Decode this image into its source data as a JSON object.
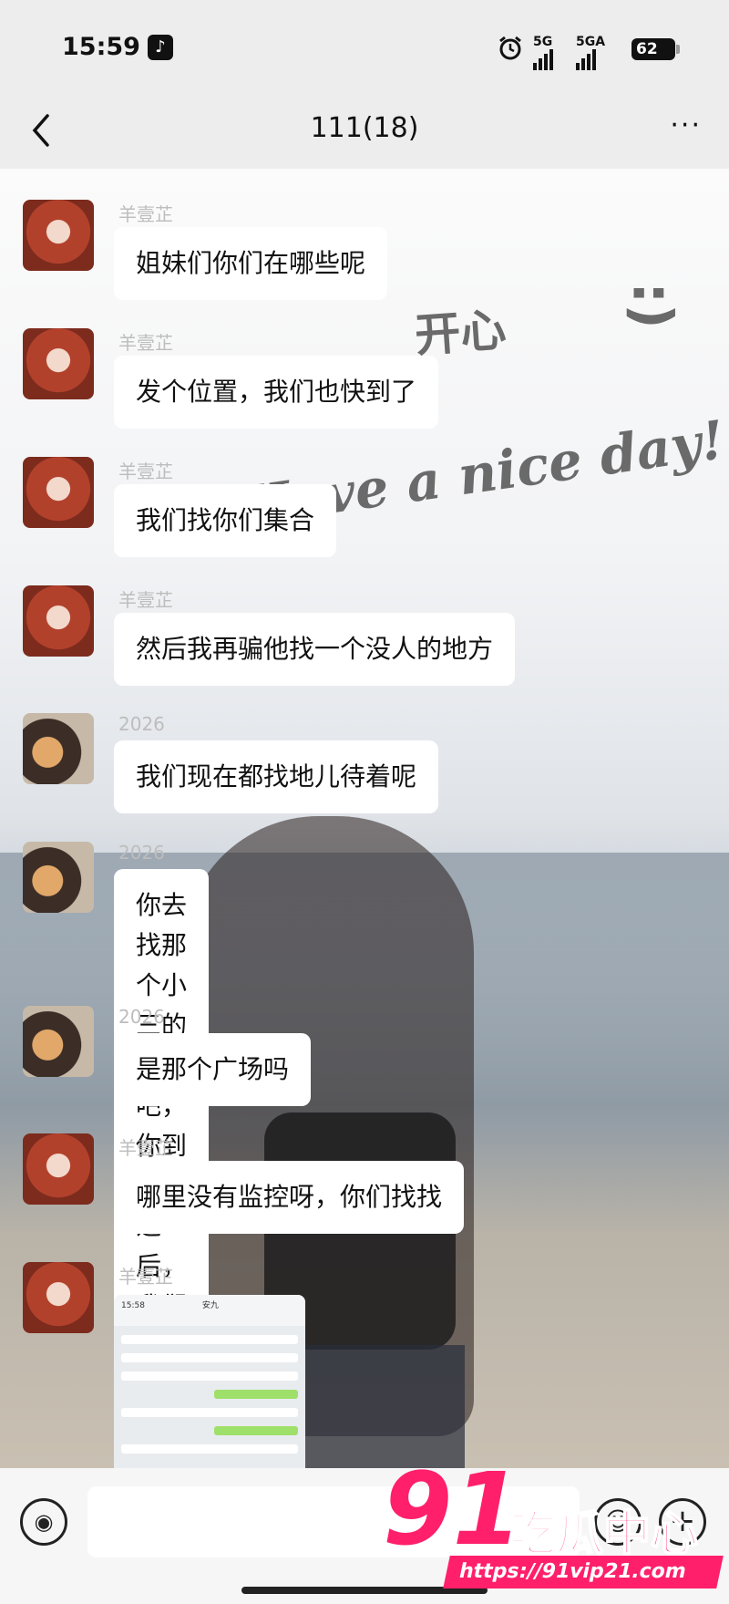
{
  "status_bar": {
    "time": "15:59",
    "signal_1": "5G",
    "signal_2": "5GA",
    "battery": "62"
  },
  "header": {
    "title": "111(18)",
    "more": "···"
  },
  "background_text": {
    "kaixin": "开心",
    "smiley": ":)",
    "slogan": "Have a nice day!"
  },
  "messages": [
    {
      "sender": "羊壹芷",
      "text": "姐妹们你们在哪些呢"
    },
    {
      "sender": "羊壹芷",
      "text": "发个位置，我们也快到了"
    },
    {
      "sender": "羊壹芷",
      "text": "我们找你们集合"
    },
    {
      "sender": "羊壹芷",
      "text": "然后我再骗他找一个没人的地方"
    },
    {
      "sender": "2026",
      "text": "我们现在都找地儿待着呢"
    },
    {
      "sender": "2026",
      "text": "你去找那个小三的地方吧，你到了\n之后，我们就再过去"
    },
    {
      "sender": "2026",
      "text": "是那个广场吗"
    },
    {
      "sender": "羊壹芷",
      "text": "哪里没有监控呀，你们找找"
    },
    {
      "sender": "羊壹芷",
      "image_time": "15:58",
      "image_title": "安九"
    }
  ],
  "watermark": {
    "number": "91",
    "name": "吃瓜中心",
    "url": "https://91vip21.com"
  }
}
